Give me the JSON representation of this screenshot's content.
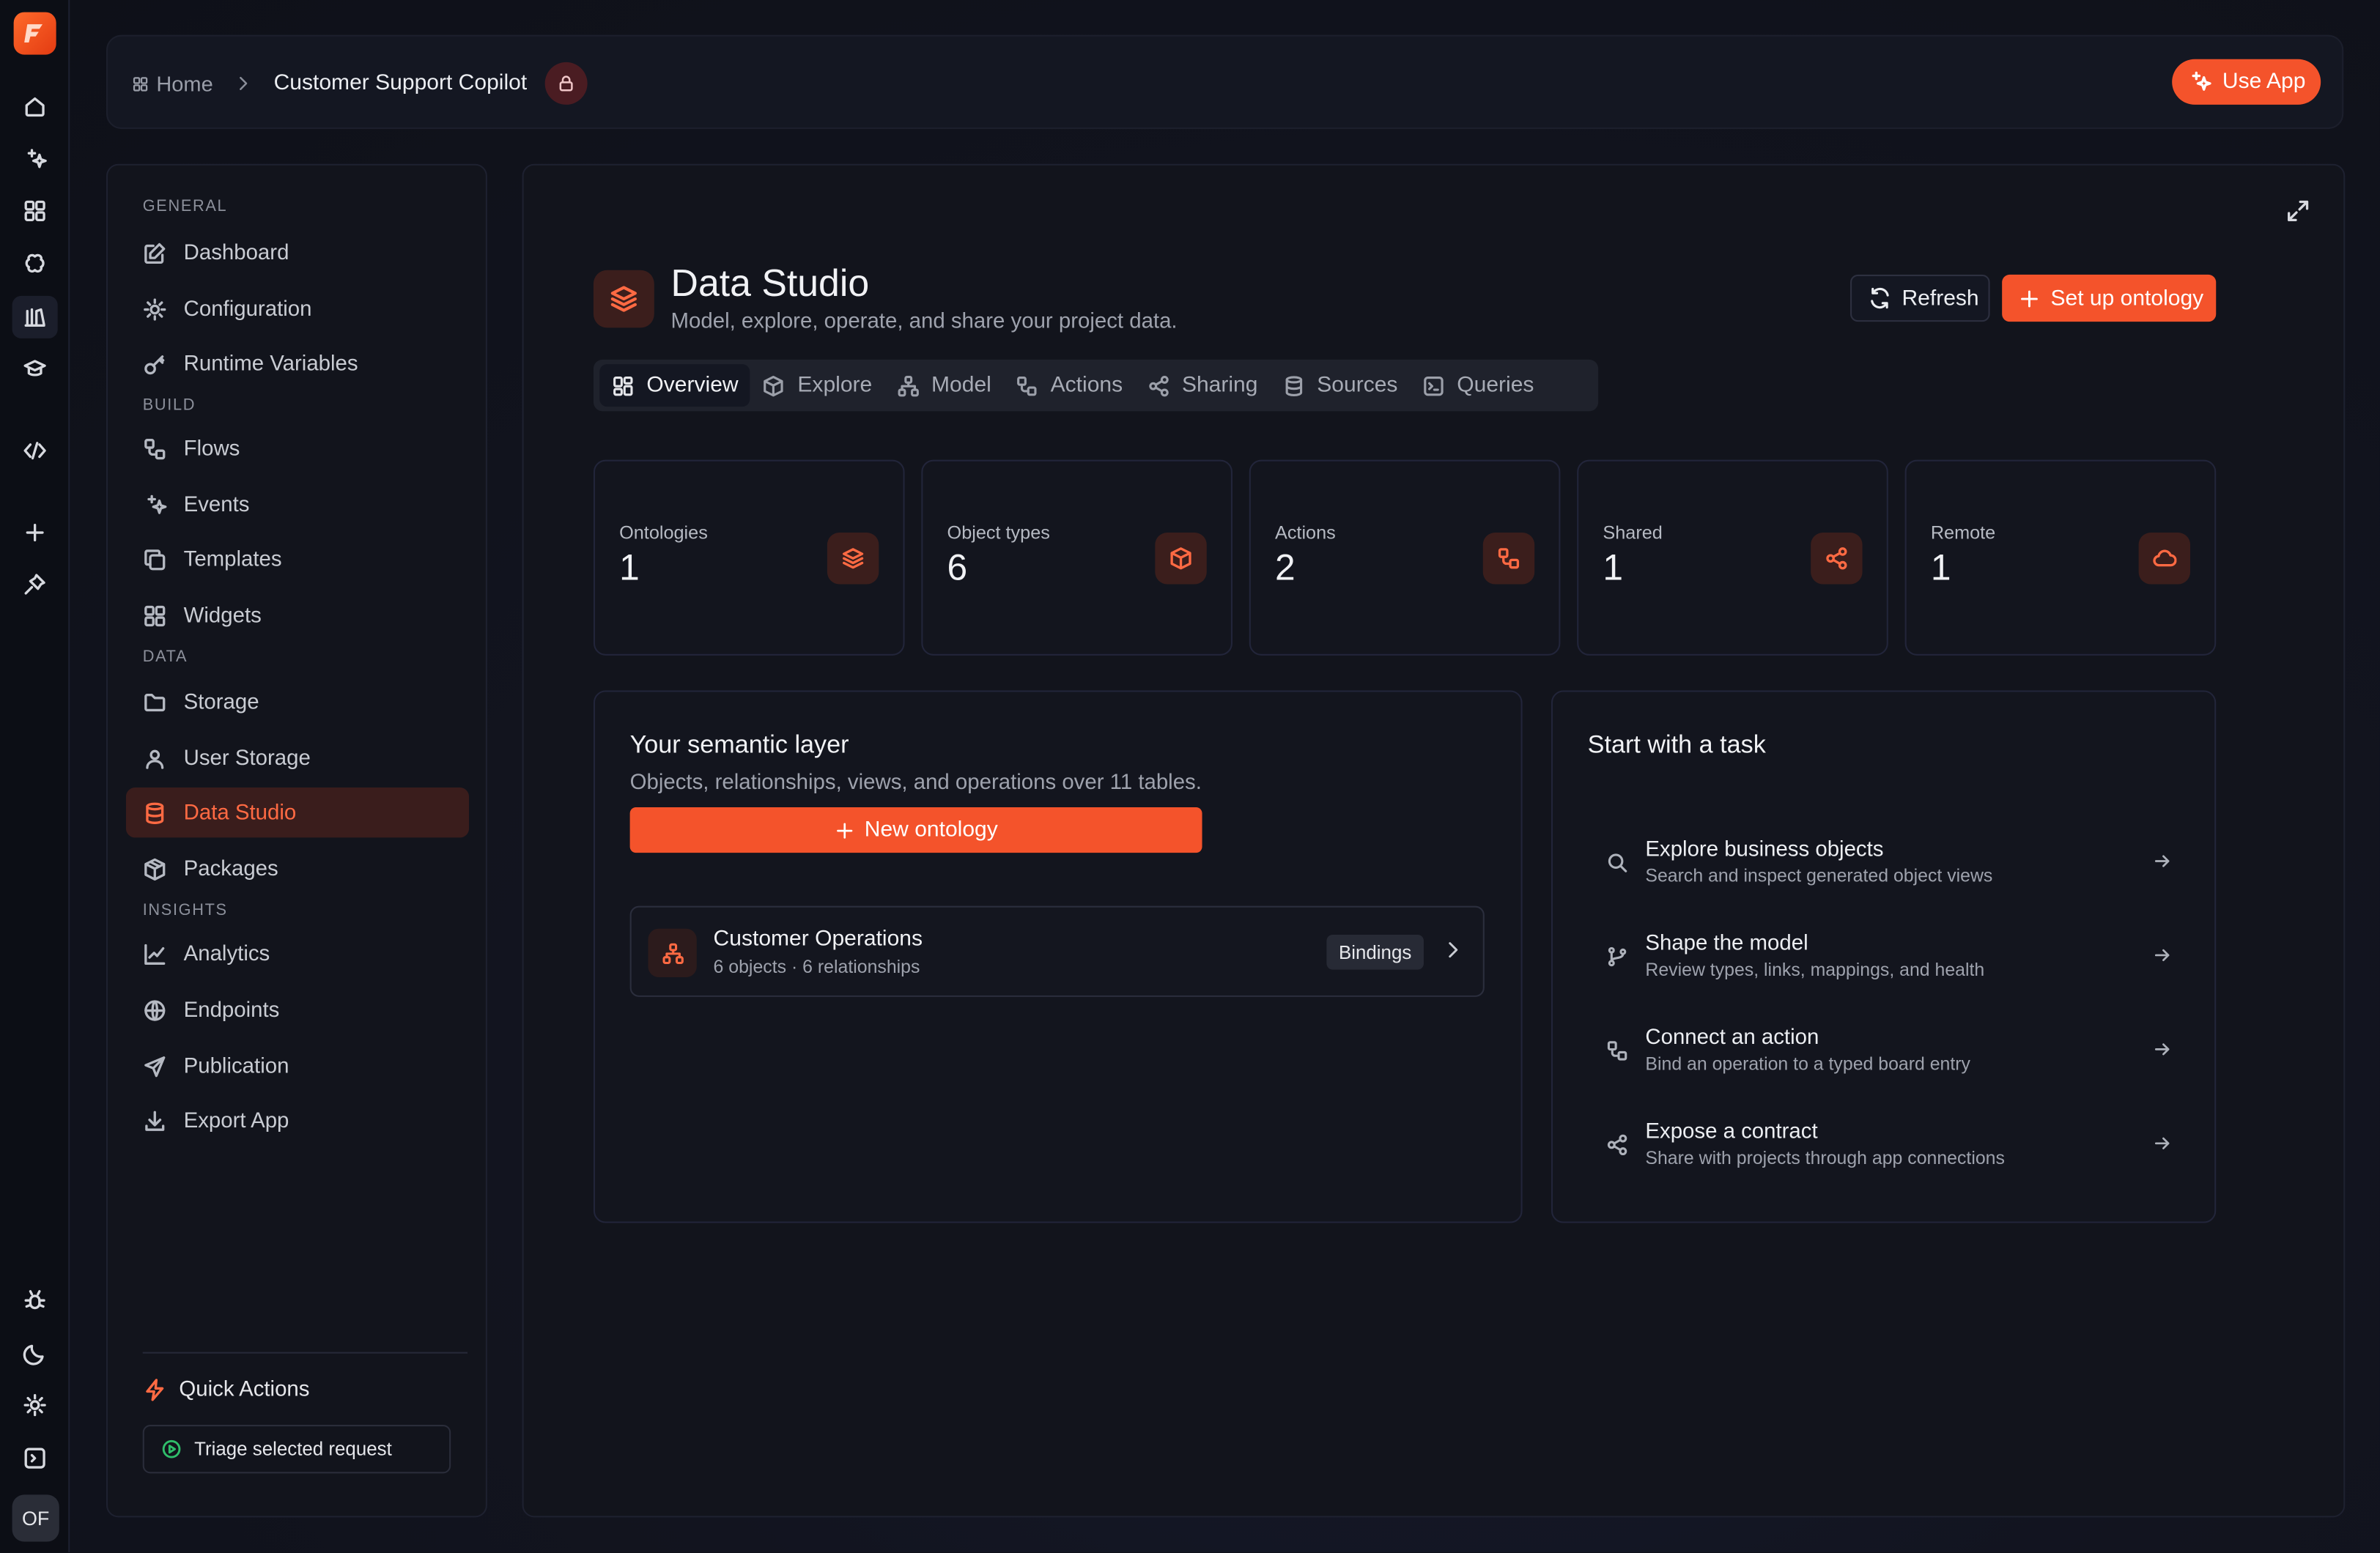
{
  "app": {
    "avatar_initials": "OF",
    "brand_color": "#f4532b"
  },
  "rail": {
    "icons": [
      "home-icon",
      "sparkle-icon",
      "grid-icon",
      "brain-icon",
      "library-icon",
      "graduation-cap-icon",
      "code-icon",
      "plus-icon",
      "pin-icon",
      "bug-icon",
      "moon-icon",
      "gear-icon",
      "terminal-icon"
    ]
  },
  "header": {
    "breadcrumb_home": "Home",
    "breadcrumb_current": "Customer Support Copilot",
    "use_app_label": "Use App"
  },
  "sidebar": {
    "sections": {
      "general": "GENERAL",
      "build": "BUILD",
      "data": "DATA",
      "insights": "INSIGHTS"
    },
    "items": {
      "dashboard": "Dashboard",
      "configuration": "Configuration",
      "runtime_variables": "Runtime Variables",
      "flows": "Flows",
      "events": "Events",
      "templates": "Templates",
      "widgets": "Widgets",
      "storage": "Storage",
      "user_storage": "User Storage",
      "data_studio": "Data Studio",
      "packages": "Packages",
      "analytics": "Analytics",
      "endpoints": "Endpoints",
      "publication": "Publication",
      "export_app": "Export App"
    },
    "active_item": "Data Studio",
    "quick_actions_title": "Quick Actions",
    "quick_action_button": "Triage selected request"
  },
  "main": {
    "title": "Data Studio",
    "subtitle": "Model, explore, operate, and share your project data.",
    "refresh_label": "Refresh",
    "setup_label": "Set up ontology",
    "tabs": [
      "Overview",
      "Explore",
      "Model",
      "Actions",
      "Sharing",
      "Sources",
      "Queries"
    ],
    "active_tab": "Overview",
    "stats": [
      {
        "label": "Ontologies",
        "value": "1",
        "icon": "layers-icon"
      },
      {
        "label": "Object types",
        "value": "6",
        "icon": "cube-icon"
      },
      {
        "label": "Actions",
        "value": "2",
        "icon": "workflow-icon"
      },
      {
        "label": "Shared",
        "value": "1",
        "icon": "share-icon"
      },
      {
        "label": "Remote",
        "value": "1",
        "icon": "cloud-icon"
      }
    ],
    "semantic": {
      "title": "Your semantic layer",
      "subtitle": "Objects, relationships, views, and operations over 11 tables.",
      "new_button": "New ontology",
      "ontology": {
        "name": "Customer Operations",
        "meta": "6 objects · 6 relationships",
        "badge": "Bindings"
      }
    },
    "tasks": {
      "title": "Start with a task",
      "items": [
        {
          "title": "Explore business objects",
          "desc": "Search and inspect generated object views",
          "icon": "search-icon"
        },
        {
          "title": "Shape the model",
          "desc": "Review types, links, mappings, and health",
          "icon": "git-branch-icon"
        },
        {
          "title": "Connect an action",
          "desc": "Bind an operation to a typed board entry",
          "icon": "workflow-icon"
        },
        {
          "title": "Expose a contract",
          "desc": "Share with projects through app connections",
          "icon": "share-icon"
        }
      ]
    }
  }
}
